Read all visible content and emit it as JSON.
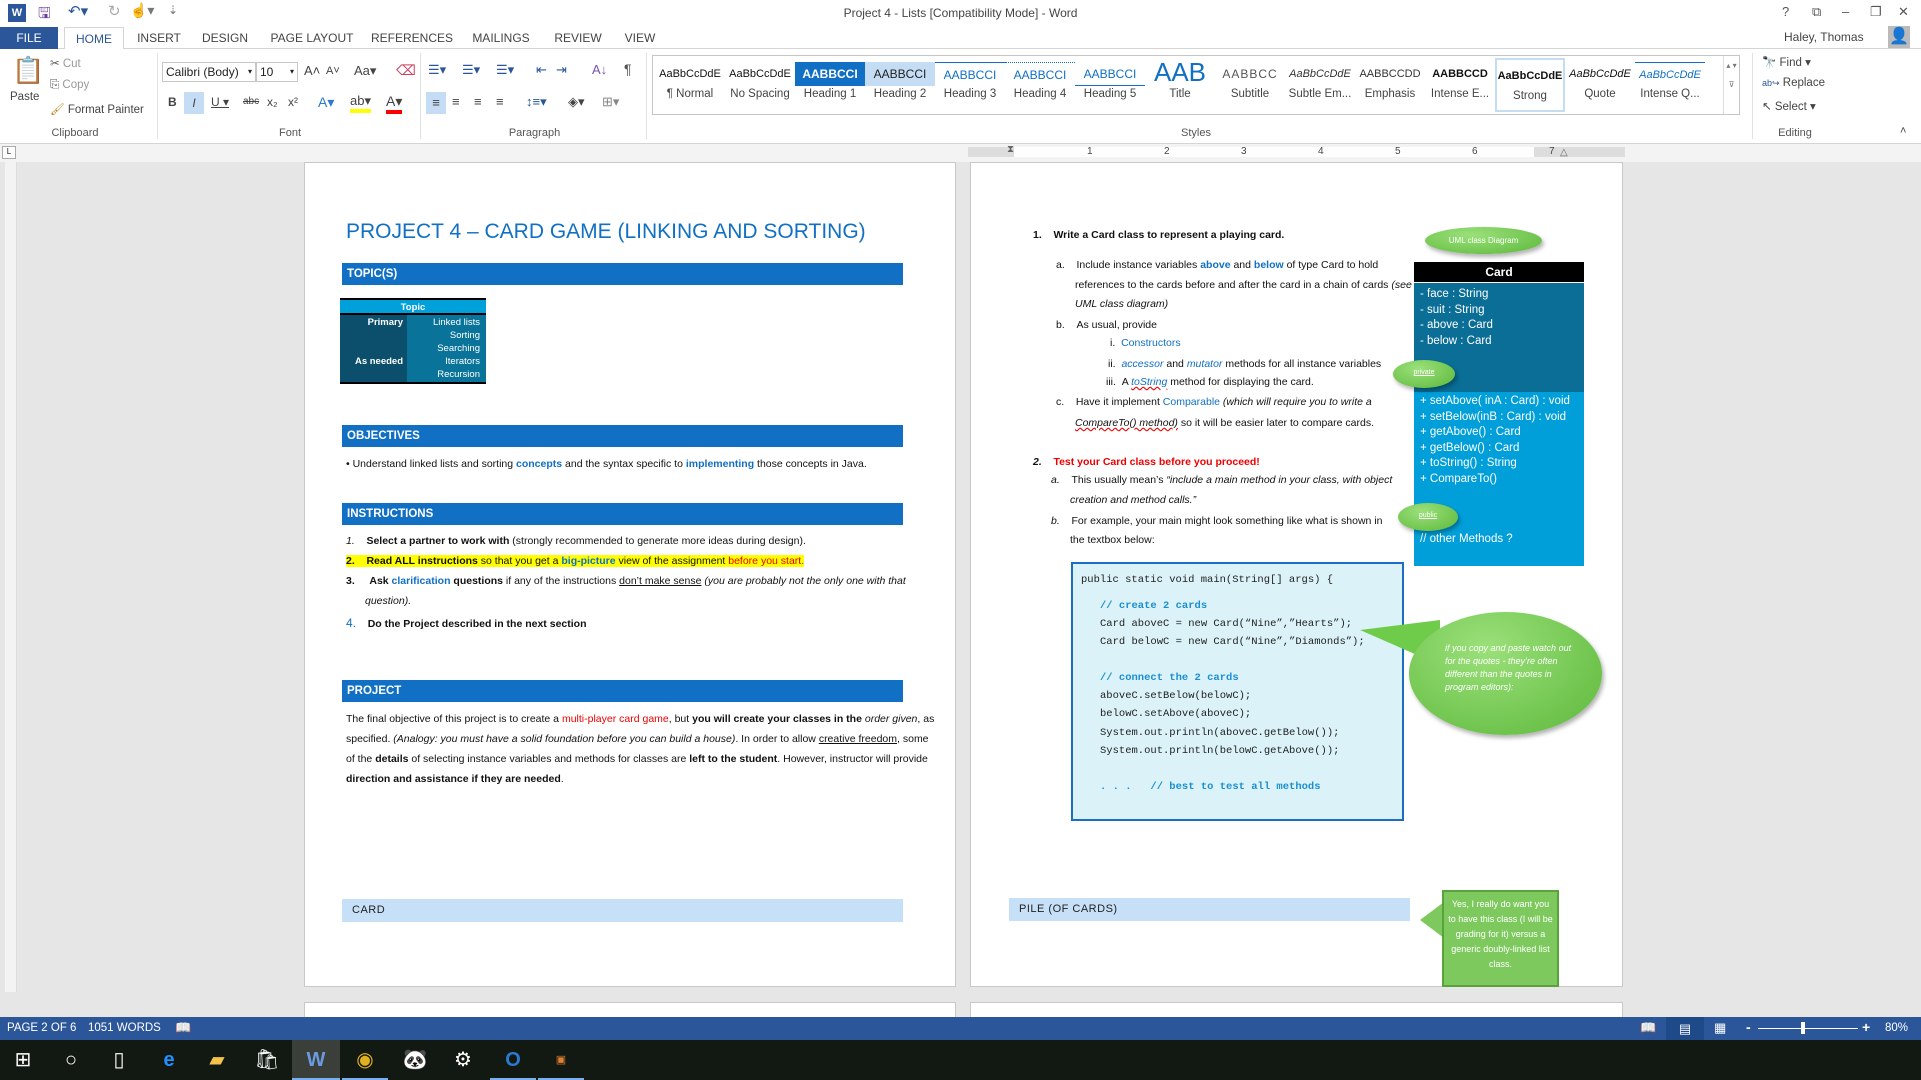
{
  "window": {
    "title": "Project 4 - Lists [Compatibility Mode] - Word",
    "user": "Haley, Thomas",
    "controls": [
      "?",
      "⧉",
      "–",
      "❐",
      "✕"
    ]
  },
  "quick_access": {
    "icons": [
      "word-icon",
      "save-icon",
      "undo-icon",
      "redo-icon",
      "touch-mode-icon",
      "customize-icon"
    ]
  },
  "tabs": [
    "FILE",
    "HOME",
    "INSERT",
    "DESIGN",
    "PAGE LAYOUT",
    "REFERENCES",
    "MAILINGS",
    "REVIEW",
    "VIEW"
  ],
  "active_tab": "HOME",
  "ribbon": {
    "clipboard": {
      "label": "Clipboard",
      "paste": "Paste",
      "cut": "Cut",
      "copy": "Copy",
      "format_painter": "Format Painter"
    },
    "font": {
      "label": "Font",
      "font_name": "Calibri (Body)",
      "font_size": "10",
      "highlight_color": "#ffff00",
      "font_color": "#ff0000"
    },
    "paragraph": {
      "label": "Paragraph"
    },
    "styles": {
      "label": "Styles",
      "items": [
        {
          "sample": "AaBbCcDdE",
          "label": "¶ Normal"
        },
        {
          "sample": "AaBbCcDdE",
          "label": "No Spacing"
        },
        {
          "sample": "AABBCCI",
          "label": "Heading 1"
        },
        {
          "sample": "AABBCCI",
          "label": "Heading 2"
        },
        {
          "sample": "AABBCCI",
          "label": "Heading 3"
        },
        {
          "sample": "AABBCCI",
          "label": "Heading 4"
        },
        {
          "sample": "AABBCCI",
          "label": "Heading 5"
        },
        {
          "sample": "AAB",
          "label": "Title"
        },
        {
          "sample": "AABBCC",
          "label": "Subtitle"
        },
        {
          "sample": "AaBbCcDdE",
          "label": "Subtle Em..."
        },
        {
          "sample": "AABBCCDD",
          "label": "Emphasis"
        },
        {
          "sample": "AABBCCD",
          "label": "Intense E..."
        },
        {
          "sample": "AaBbCcDdE",
          "label": "Strong"
        },
        {
          "sample": "AaBbCcDdE",
          "label": "Quote"
        },
        {
          "sample": "AaBbCcDdE",
          "label": "Intense Q..."
        }
      ]
    },
    "editing": {
      "label": "Editing",
      "find": "Find",
      "replace": "Replace",
      "select": "Select"
    }
  },
  "ruler": {
    "numbers": [
      "1",
      "2",
      "3",
      "4",
      "5",
      "6",
      "7"
    ]
  },
  "page_left": {
    "title": "PROJECT 4 – CARD GAME (LINKING AND SORTING)",
    "topics_header": "TOPIC(S)",
    "topic_table": {
      "header": "Topic",
      "rows": [
        [
          "Primary",
          "Linked lists"
        ],
        [
          "",
          "Sorting"
        ],
        [
          "",
          "Searching"
        ],
        [
          "As needed",
          "Iterators"
        ],
        [
          "",
          "Recursion"
        ]
      ]
    },
    "objectives_header": "OBJECTIVES",
    "objective": [
      "Understand linked lists and sorting ",
      "concepts",
      " and the syntax specific to ",
      "implementing",
      " those concepts in Java."
    ],
    "instructions_header": "INSTRUCTIONS",
    "instructions": [
      {
        "num": "1.",
        "parts": [
          "Select a partner to work with",
          " (strongly recommended to generate more ideas during design)."
        ]
      },
      {
        "num": "2.",
        "parts": [
          "Read ALL instructions",
          " so that you get a ",
          "big-picture",
          " view of the assignment ",
          "before you start."
        ]
      },
      {
        "num": "3.",
        "parts": [
          "Ask ",
          "clarification",
          " questions",
          " if any of the instructions ",
          "don’t make sense",
          " (you are probably not the only one with that",
          "question)."
        ]
      },
      {
        "num": "4.",
        "parts": [
          "Do the Project described in the next section"
        ]
      }
    ],
    "project_header": "PROJECT",
    "project_text": [
      "The final objective of this project is to create a ",
      "multi-player card game",
      ", but ",
      "you will create your classes in the ",
      "order given",
      ", as",
      "specified.  ",
      "(Analogy: you must have a solid foundation before you can build a house)",
      ".  In order to allow ",
      "creative freedom",
      ", some",
      "of the ",
      "details",
      " of selecting instance variables and methods for classes are ",
      "left to the student",
      ".  However, instructor will provide",
      "direction and assistance if they are needed",
      "."
    ],
    "card_header": "CARD"
  },
  "page_right": {
    "item1": {
      "num": "1.",
      "text": "Write a Card class to represent a playing card."
    },
    "item1a": [
      "a.",
      "Include instance variables ",
      "above",
      " and ",
      "below",
      " of type Card to hold",
      "references to the cards before and after the card in a chain of cards ",
      "(see",
      "UML class diagram)"
    ],
    "item1b": [
      "b.",
      "As usual, provide"
    ],
    "item1b_sub": [
      [
        "i.",
        "Constructors"
      ],
      [
        "ii.",
        "accessor",
        " and ",
        "mutator",
        " methods for all instance variables"
      ],
      [
        "iii.",
        "A ",
        "toString",
        " method for displaying the card."
      ]
    ],
    "item1c": [
      "c.",
      "Have it implement ",
      "Comparable",
      " (which will require you to write a",
      "CompareTo()  method)",
      " so it will be easier later to compare cards."
    ],
    "item2": {
      "num": "2.",
      "text": "Test your Card class before you proceed!"
    },
    "item2a": [
      "a.",
      "This usually mean’s ",
      "“include a main method in your class, with object",
      "creation and method calls.”"
    ],
    "item2b": [
      "b.",
      "For example, your main might look something like what is shown in",
      "the textbox below:"
    ],
    "code": [
      "public static void main(String[] args) {",
      "// create 2 cards",
      "Card aboveC = new Card(“Nine”,”Hearts”);",
      "Card belowC = new Card(“Nine”,”Diamonds”);",
      "// connect the 2 cards",
      "aboveC.setBelow(belowC);",
      "belowC.setAbove(aboveC);",
      "System.out.println(aboveC.getBelow());",
      "System.out.println(belowC.getAbove());",
      ". . .   // best to test all methods"
    ],
    "uml": {
      "bubble": "UML class Diagram",
      "class_name": "Card",
      "attributes": [
        "- face : String",
        "- suit : String",
        "- above : Card",
        "- below : Card"
      ],
      "private_label": "private",
      "methods": [
        "+ setAbove( inA : Card) : void",
        "+ setBelow(inB : Card) : void",
        "+ getAbove() : Card",
        "+ getBelow() : Card",
        "+ toString() : String",
        "+ CompareTo()"
      ],
      "public_label": "public",
      "other": "// other Methods  ?"
    },
    "quote_callout": "if you copy and paste watch out for the quotes - they’re often different than the quotes in program editors):",
    "pile_header": "PILE (OF CARDS)",
    "pile_callout": "Yes, I really do want you to have this class (I will be grading for it) versus a generic doubly-linked list class."
  },
  "status": {
    "page": "PAGE 2 OF 6",
    "words": "1051 WORDS",
    "zoom": "80%",
    "zoom_fraction": 0.45
  },
  "taskbar": {
    "icons": [
      "start-icon",
      "cortana-icon",
      "task-view-icon",
      "edge-icon",
      "file-explorer-icon",
      "store-icon",
      "word-icon",
      "chrome-icon",
      "app-icon",
      "settings-icon",
      "outlook-icon",
      "java-ee-ide-icon"
    ]
  },
  "colors": {
    "accent": "#2b579a",
    "heading_bar": "#1170c4",
    "light_bar": "#c6e0f8",
    "uml_dark": "#0a6e96",
    "uml_light": "#009fd9"
  }
}
